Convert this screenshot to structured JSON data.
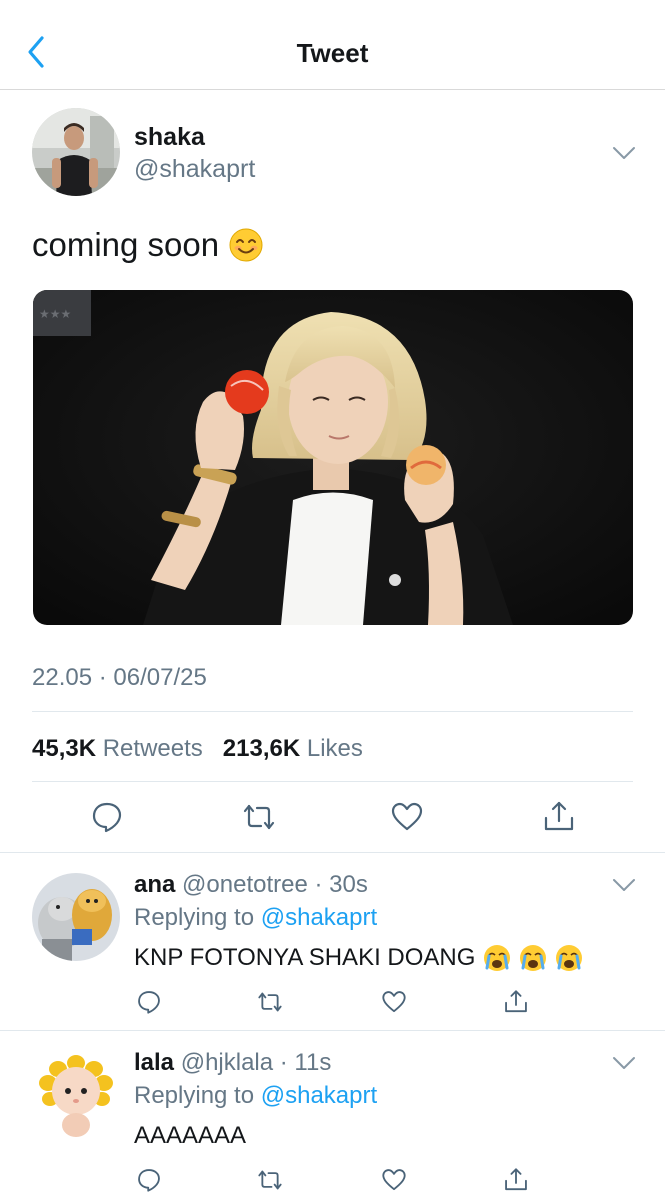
{
  "header": {
    "title": "Tweet"
  },
  "author": {
    "name": "shaka",
    "handle": "@shakaprt"
  },
  "tweet": {
    "text": "coming soon",
    "timestamp": "22.05 · 06/07/25"
  },
  "stats": {
    "retweets": "45,3K",
    "retweets_label": "Retweets",
    "likes": "213,6K",
    "likes_label": "Likes"
  },
  "replies": [
    {
      "name": "ana",
      "meta": "@onetotree · 30s",
      "replying_prefix": "Replying to",
      "replying_mention": "@shakaprt",
      "text": "KNP FOTONYA SHAKI DOANG"
    },
    {
      "name": "lala",
      "meta": "@hjklala · 11s",
      "replying_prefix": "Replying to",
      "replying_mention": "@shakaprt",
      "text": "AAAAAAA"
    }
  ],
  "colors": {
    "accent": "#1da1f2",
    "muted": "#657786",
    "icon": "#4a6378"
  }
}
